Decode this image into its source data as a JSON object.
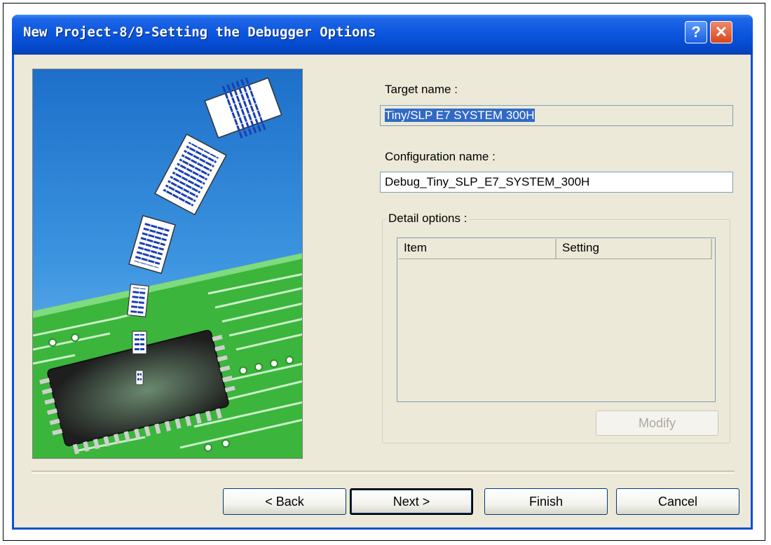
{
  "dialog": {
    "title": "New Project-8/9-Setting the Debugger Options",
    "help_button": "?",
    "close_button": "✕"
  },
  "form": {
    "target_label": "Target name :",
    "target_value": "Tiny/SLP E7 SYSTEM 300H",
    "config_label": "Configuration name :",
    "config_value": "Debug_Tiny_SLP_E7_SYSTEM_300H",
    "detail_label": "Detail options :",
    "columns": [
      "Item",
      "Setting"
    ],
    "modify_button": "Modify"
  },
  "footer": {
    "back": "< Back",
    "next": "Next >",
    "finish": "Finish",
    "cancel": "Cancel"
  },
  "colors": {
    "titlebar": "#0a55de",
    "window_bg": "#ece9d8",
    "selection": "#316ac5"
  },
  "icons": [
    "help-icon",
    "close-icon",
    "wizard-illustration"
  ]
}
